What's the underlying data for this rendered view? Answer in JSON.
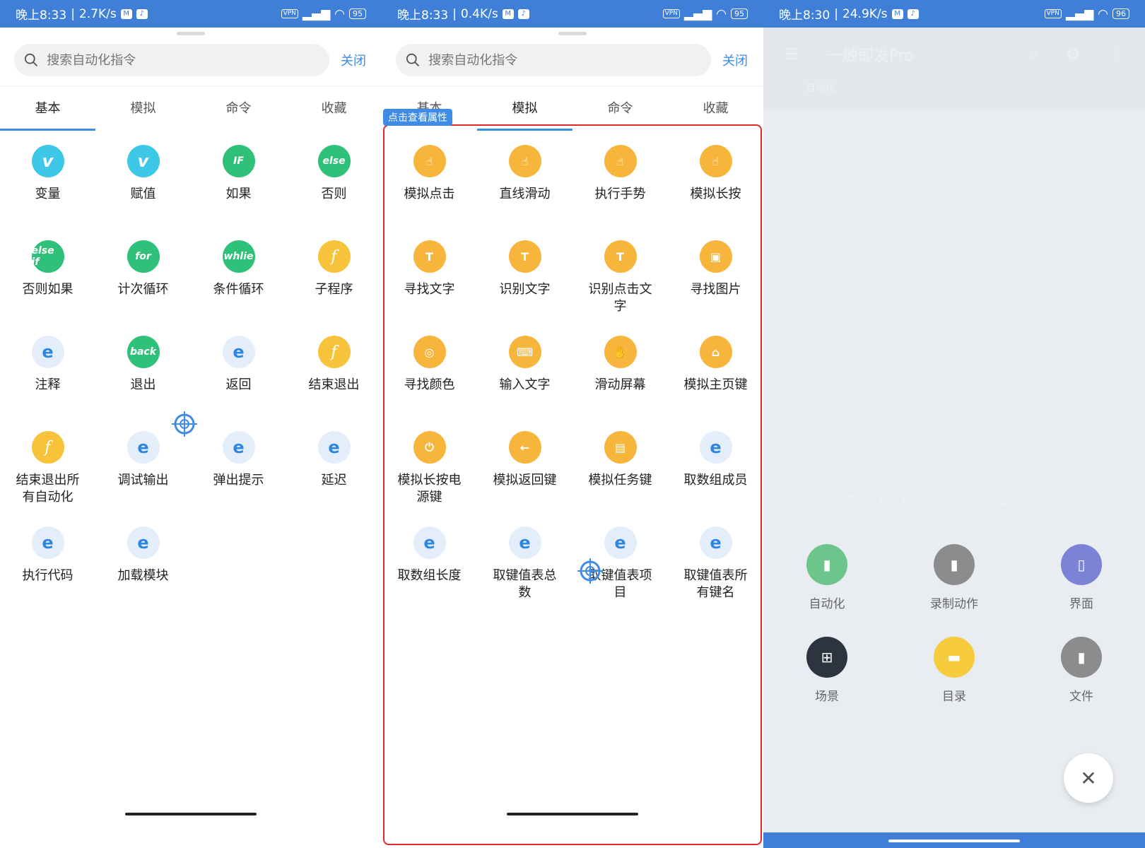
{
  "panel1": {
    "status": {
      "time": "晚上8:33",
      "speed": "2.7K/s",
      "battery": "95"
    },
    "search_placeholder": "搜索自动化指令",
    "close_label": "关闭",
    "tabs": [
      "基本",
      "模拟",
      "命令",
      "收藏"
    ],
    "active_tab": 0,
    "items": [
      {
        "label": "变量",
        "icon": "v-icon",
        "glyph": "v",
        "style": "ic-v"
      },
      {
        "label": "赋值",
        "icon": "v-icon",
        "glyph": "v",
        "style": "ic-v"
      },
      {
        "label": "如果",
        "icon": "if-icon",
        "glyph": "IF",
        "style": "ic-g"
      },
      {
        "label": "否则",
        "icon": "else-icon",
        "glyph": "else",
        "style": "ic-g"
      },
      {
        "label": "否则如果",
        "icon": "else-if-icon",
        "glyph": "else if",
        "style": "ic-g"
      },
      {
        "label": "计次循环",
        "icon": "for-icon",
        "glyph": "for",
        "style": "ic-g"
      },
      {
        "label": "条件循环",
        "icon": "while-icon",
        "glyph": "whlie",
        "style": "ic-g"
      },
      {
        "label": "子程序",
        "icon": "function-icon",
        "glyph": "f",
        "style": "ic-y"
      },
      {
        "label": "注释",
        "icon": "module-icon",
        "glyph": "e",
        "style": "ic-b"
      },
      {
        "label": "退出",
        "icon": "back-icon",
        "glyph": "back",
        "style": "ic-g"
      },
      {
        "label": "返回",
        "icon": "module-icon",
        "glyph": "e",
        "style": "ic-b"
      },
      {
        "label": "结束退出",
        "icon": "function-icon",
        "glyph": "f",
        "style": "ic-y"
      },
      {
        "label": "结束退出所有自动化",
        "icon": "function-icon",
        "glyph": "f",
        "style": "ic-y"
      },
      {
        "label": "调试输出",
        "icon": "module-icon",
        "glyph": "e",
        "style": "ic-b"
      },
      {
        "label": "弹出提示",
        "icon": "module-icon",
        "glyph": "e",
        "style": "ic-b"
      },
      {
        "label": "延迟",
        "icon": "module-icon",
        "glyph": "e",
        "style": "ic-b"
      },
      {
        "label": "执行代码",
        "icon": "module-icon",
        "glyph": "e",
        "style": "ic-b"
      },
      {
        "label": "加载模块",
        "icon": "module-icon",
        "glyph": "e",
        "style": "ic-b"
      }
    ]
  },
  "panel2": {
    "status": {
      "time": "晚上8:33",
      "speed": "0.4K/s",
      "battery": "95"
    },
    "search_placeholder": "搜索自动化指令",
    "close_label": "关闭",
    "tabs": [
      "基本",
      "模拟",
      "命令",
      "收藏"
    ],
    "active_tab": 1,
    "tooltip": "点击查看属性",
    "items": [
      {
        "label": "模拟点击",
        "icon": "tap-icon",
        "glyph": "☝",
        "style": "ic-o"
      },
      {
        "label": "直线滑动",
        "icon": "tap-icon",
        "glyph": "☝",
        "style": "ic-o"
      },
      {
        "label": "执行手势",
        "icon": "tap-icon",
        "glyph": "☝",
        "style": "ic-o"
      },
      {
        "label": "模拟长按",
        "icon": "tap-icon",
        "glyph": "☝",
        "style": "ic-o"
      },
      {
        "label": "寻找文字",
        "icon": "text-scan-icon",
        "glyph": "T",
        "style": "ic-o"
      },
      {
        "label": "识别文字",
        "icon": "text-scan-icon",
        "glyph": "T",
        "style": "ic-o"
      },
      {
        "label": "识别点击文字",
        "icon": "text-scan-icon",
        "glyph": "T",
        "style": "ic-o"
      },
      {
        "label": "寻找图片",
        "icon": "image-scan-icon",
        "glyph": "▣",
        "style": "ic-o"
      },
      {
        "label": "寻找颜色",
        "icon": "color-scan-icon",
        "glyph": "◎",
        "style": "ic-o"
      },
      {
        "label": "输入文字",
        "icon": "keyboard-icon",
        "glyph": "⌨",
        "style": "ic-o"
      },
      {
        "label": "滑动屏幕",
        "icon": "hand-icon",
        "glyph": "✋",
        "style": "ic-o"
      },
      {
        "label": "模拟主页键",
        "icon": "home-icon",
        "glyph": "⌂",
        "style": "ic-o"
      },
      {
        "label": "模拟长按电源键",
        "icon": "power-icon",
        "glyph": "⏻",
        "style": "ic-o"
      },
      {
        "label": "模拟返回键",
        "icon": "arrow-left-icon",
        "glyph": "←",
        "style": "ic-o"
      },
      {
        "label": "模拟任务键",
        "icon": "task-icon",
        "glyph": "▤",
        "style": "ic-o"
      },
      {
        "label": "取数组成员",
        "icon": "module-icon",
        "glyph": "e",
        "style": "ic-b"
      },
      {
        "label": "取数组长度",
        "icon": "module-icon",
        "glyph": "e",
        "style": "ic-b"
      },
      {
        "label": "取键值表总数",
        "icon": "module-icon",
        "glyph": "e",
        "style": "ic-b"
      },
      {
        "label": "取键值表项目",
        "icon": "module-icon",
        "glyph": "e",
        "style": "ic-b"
      },
      {
        "label": "取键值表所有键名",
        "icon": "module-icon",
        "glyph": "e",
        "style": "ic-b"
      }
    ]
  },
  "panel3": {
    "status": {
      "time": "晚上8:30",
      "speed": "24.9K/s",
      "battery": "96"
    },
    "app_title": "一触即发Pro",
    "sub_tab": "自动化",
    "empty_text": "这里什么都没有，点击下方 + 创建一个自动化吧",
    "fabs": [
      {
        "label": "自动化",
        "icon": "file-icon",
        "glyph": "▮",
        "color": "#6cc58a"
      },
      {
        "label": "录制动作",
        "icon": "file-icon",
        "glyph": "▮",
        "color": "#8c8c8c"
      },
      {
        "label": "界面",
        "icon": "phone-icon",
        "glyph": "▯",
        "color": "#7b83d6"
      },
      {
        "label": "场景",
        "icon": "tree-icon",
        "glyph": "⊞",
        "color": "#2c3440"
      },
      {
        "label": "目录",
        "icon": "folder-icon",
        "glyph": "▬",
        "color": "#f6cc3c"
      },
      {
        "label": "文件",
        "icon": "file-icon",
        "glyph": "▮",
        "color": "#8c8c8c"
      }
    ],
    "close_glyph": "✕"
  },
  "colors": {
    "status_bar": "#3f7fd8",
    "accent": "#3f8ce6",
    "highlight_border": "#e02828"
  }
}
